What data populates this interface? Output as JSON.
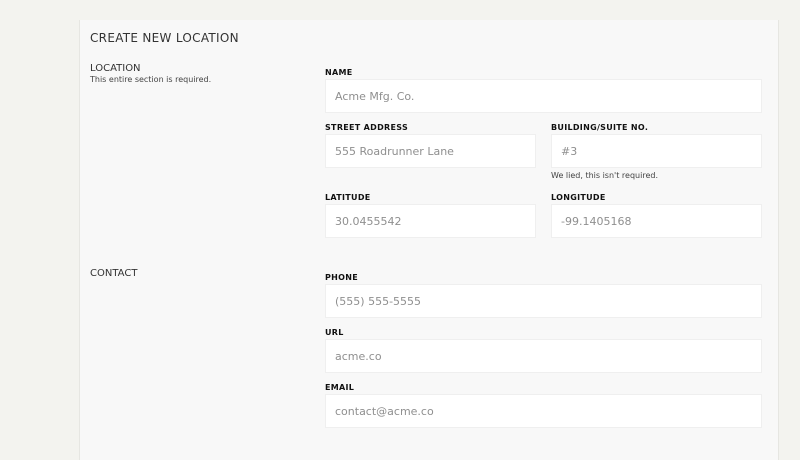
{
  "form": {
    "title": "CREATE NEW LOCATION",
    "location_section": {
      "title": "LOCATION",
      "description": "This entire section is required.",
      "fields": {
        "name": {
          "label": "NAME",
          "placeholder": "Acme Mfg. Co."
        },
        "street_address": {
          "label": "STREET ADDRESS",
          "placeholder": "555 Roadrunner Lane"
        },
        "building_suite": {
          "label": "BUILDING/SUITE NO.",
          "placeholder": "#3",
          "hint": "We lied, this isn't required."
        },
        "latitude": {
          "label": "LATITUDE",
          "placeholder": "30.0455542"
        },
        "longitude": {
          "label": "LONGITUDE",
          "placeholder": "-99.1405168"
        }
      }
    },
    "contact_section": {
      "title": "CONTACT",
      "fields": {
        "phone": {
          "label": "PHONE",
          "placeholder": "(555) 555-5555"
        },
        "url": {
          "label": "URL",
          "placeholder": "acme.co"
        },
        "email": {
          "label": "EMAIL",
          "placeholder": "contact@acme.co"
        }
      }
    }
  }
}
